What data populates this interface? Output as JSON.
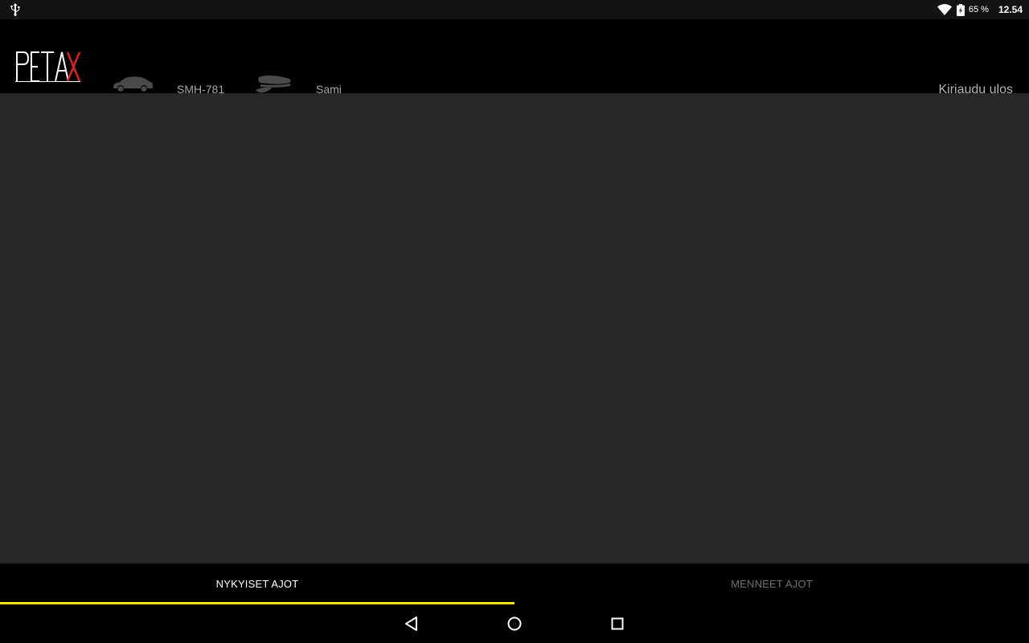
{
  "status_bar": {
    "usb_icon": "usb-icon",
    "wifi_icon": "wifi-icon",
    "battery_icon": "battery-charging-icon",
    "battery_percent": "65 %",
    "time": "12.54"
  },
  "header": {
    "logo_text": "PETAX",
    "vehicle_icon": "car-icon",
    "vehicle_plate": "SMH-781",
    "driver_icon": "driver-cap-icon",
    "driver_name": "Sami",
    "logout_label": "Kirjaudu ulos"
  },
  "tabs": [
    {
      "label": "NYKYISET AJOT",
      "active": true
    },
    {
      "label": "MENNEET AJOT",
      "active": false
    }
  ],
  "nav_bar": {
    "back_icon": "back-triangle-icon",
    "home_icon": "home-circle-icon",
    "recents_icon": "recents-square-icon"
  },
  "colors": {
    "content_bg": "#272727",
    "header_bg": "#000000",
    "tab_indicator": "#f5e11c",
    "logo_accent": "#e02020"
  }
}
